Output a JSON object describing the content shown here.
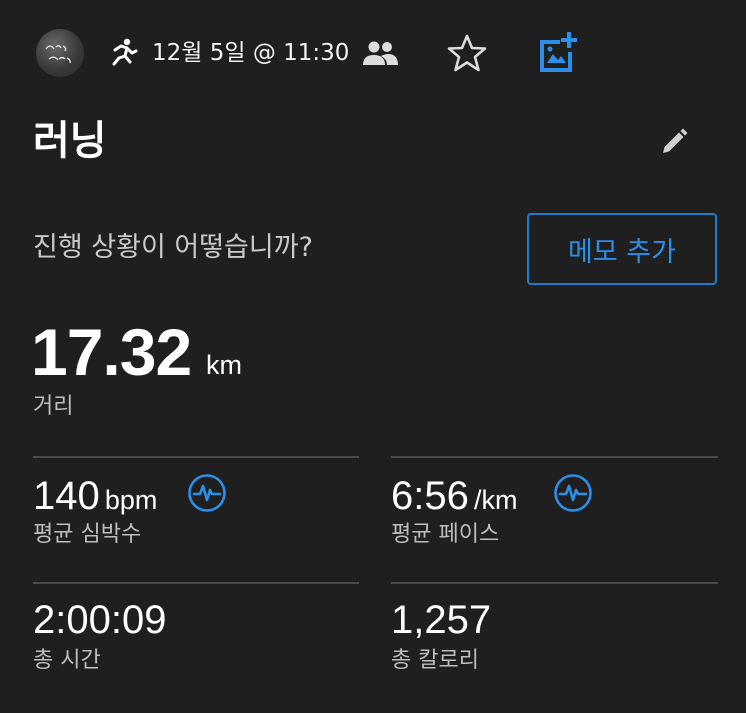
{
  "header": {
    "avatar_icon": "profile-avatar-icon",
    "activity_icon": "running-person-icon",
    "datetime": "12월 5일 @ 11:30",
    "group_icon": "people-group-icon",
    "star_icon": "star-outline-icon",
    "add_photo_icon": "add-photo-icon"
  },
  "activity": {
    "title": "러닝",
    "edit_icon": "pencil-icon"
  },
  "prompt": {
    "text": "진행 상황이 어떻습니까?",
    "memo_button_label": "메모 추가"
  },
  "distance": {
    "value": "17.32",
    "unit": "km",
    "label": "거리"
  },
  "stats": [
    {
      "value": "140",
      "unit": "bpm",
      "label": "평균 심박수",
      "icon": "heart-rate-pulse-icon"
    },
    {
      "value": "6:56",
      "unit": "/km",
      "label": "평균 페이스",
      "icon": "pace-pulse-icon"
    },
    {
      "value": "2:00:09",
      "unit": "",
      "label": "총 시간"
    },
    {
      "value": "1,257",
      "unit": "",
      "label": "총 칼로리"
    }
  ],
  "colors": {
    "background": "#1f1f1f",
    "accent": "#2c8fe8",
    "text_primary": "#ffffff",
    "text_secondary": "#bdbdbd",
    "divider": "#4a4a4a"
  }
}
